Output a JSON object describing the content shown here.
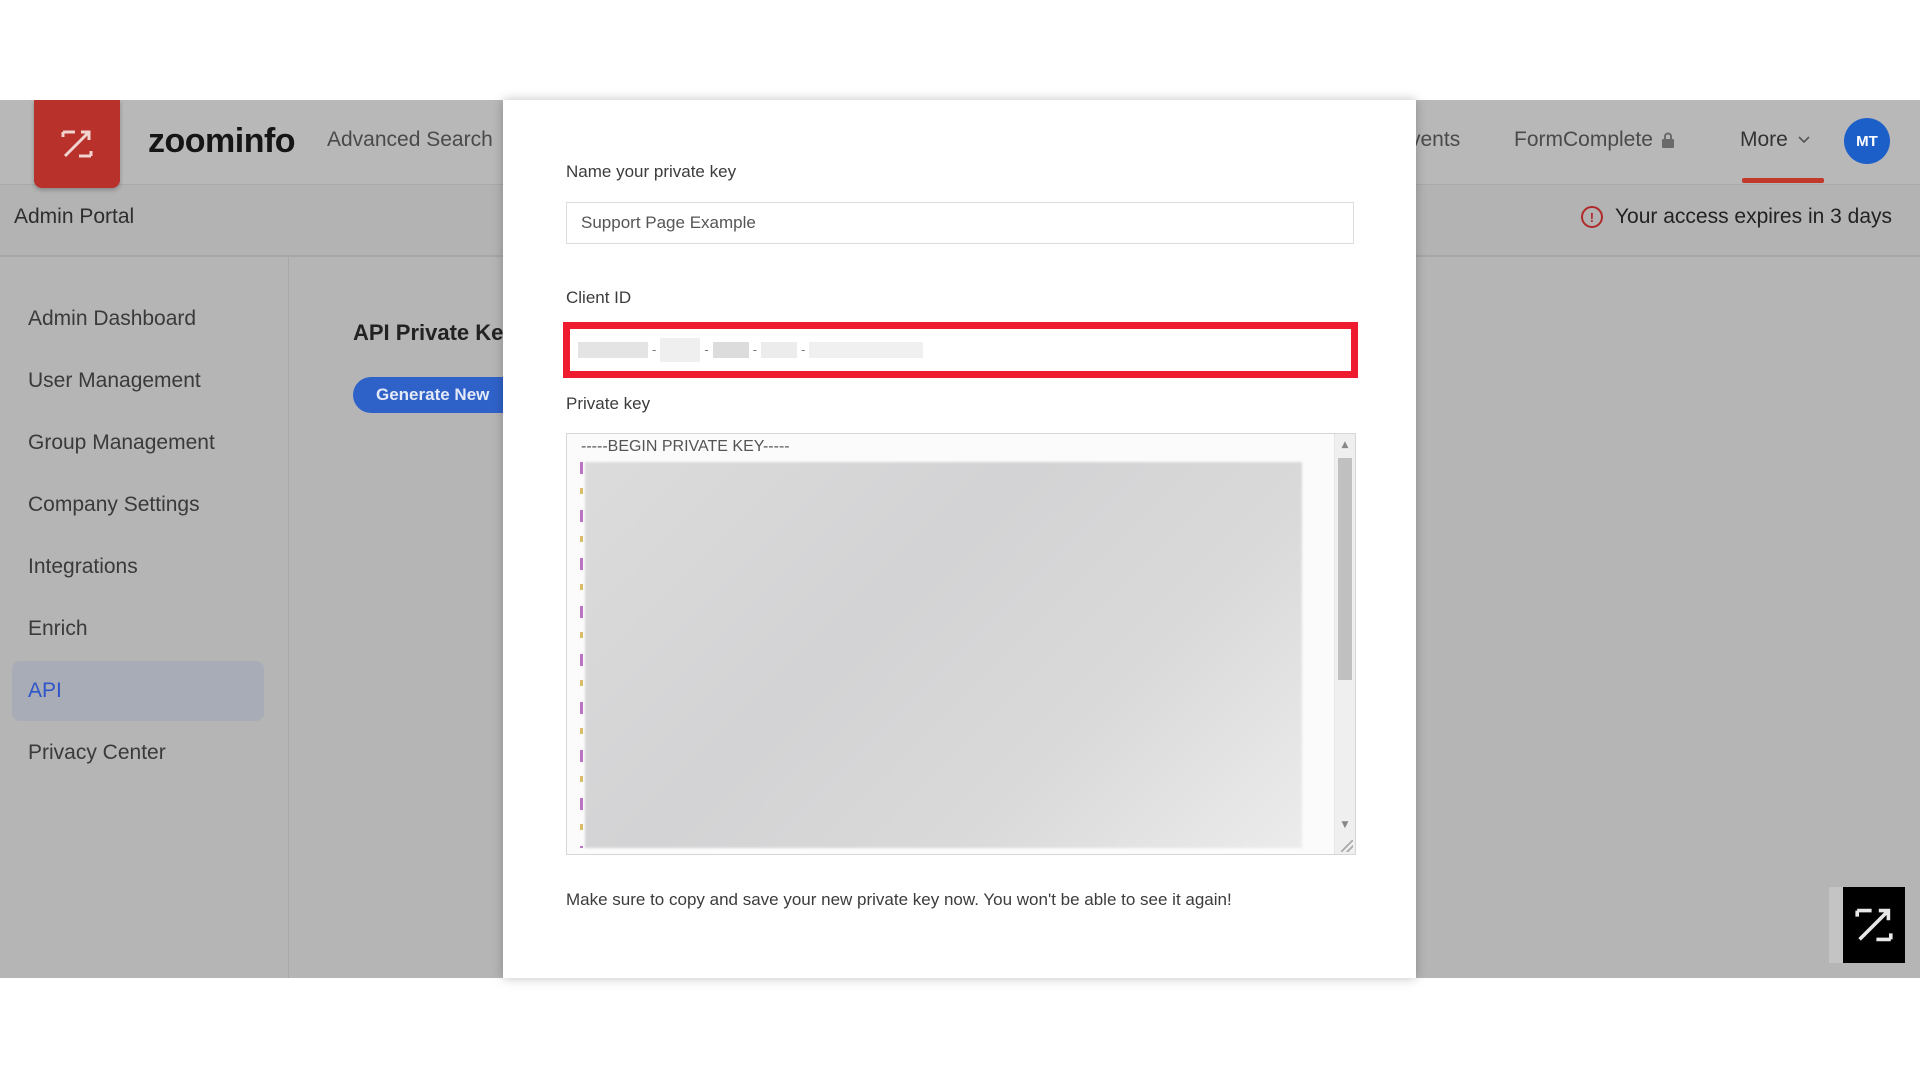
{
  "app": {
    "brand_name": "zoominfo",
    "nav": {
      "advanced_search": "Advanced Search",
      "events_partial": "vents",
      "formcomplete": "FormComplete",
      "more": "More"
    },
    "user_initials": "MT",
    "admin_portal_label": "Admin Portal",
    "access_warning": "Your access expires in 3 days",
    "colors": {
      "brand_red": "#b8322b",
      "accent_blue": "#2f62c9",
      "highlight_red": "#ee1c2e"
    }
  },
  "sidebar": {
    "items": [
      {
        "label": "Admin Dashboard",
        "active": false
      },
      {
        "label": "User Management",
        "active": false
      },
      {
        "label": "Group Management",
        "active": false
      },
      {
        "label": "Company Settings",
        "active": false
      },
      {
        "label": "Integrations",
        "active": false
      },
      {
        "label": "Enrich",
        "active": false
      },
      {
        "label": "API",
        "active": true
      },
      {
        "label": "Privacy Center",
        "active": false
      }
    ]
  },
  "content": {
    "title": "API Private Keys",
    "generate_button": "Generate New"
  },
  "modal": {
    "name_label": "Name your private key",
    "name_value": "Support Page Example",
    "client_id_label": "Client ID",
    "client_id_value": "[redacted]",
    "private_key_label": "Private key",
    "private_key_header": "-----BEGIN PRIVATE KEY-----",
    "notice": "Make sure to copy and save your new private key now. You won't be able to see it again!"
  }
}
